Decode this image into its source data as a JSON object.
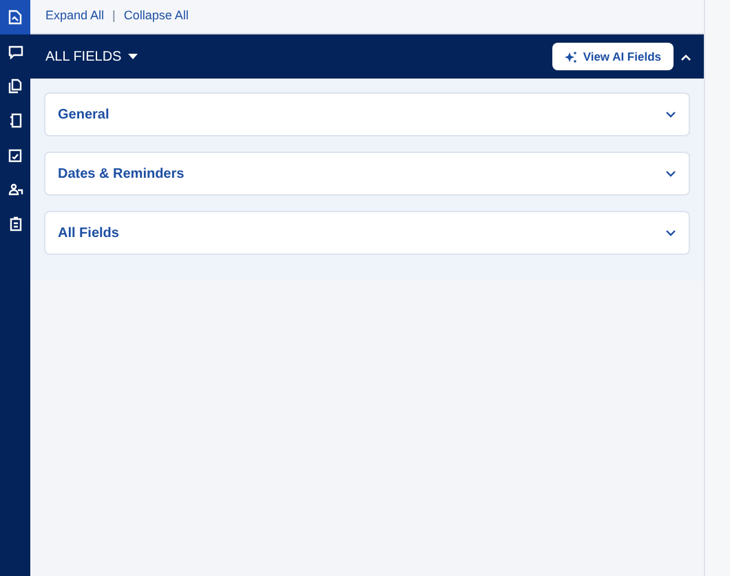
{
  "sidebar": {
    "items": [
      {
        "selected": true
      },
      {
        "selected": false
      },
      {
        "selected": false
      },
      {
        "selected": false
      },
      {
        "selected": false
      },
      {
        "selected": false
      },
      {
        "selected": false
      }
    ]
  },
  "toolbar": {
    "links": [
      "Expand All",
      "Collapse All"
    ],
    "separator": "|"
  },
  "header": {
    "title": "ALL FIELDS",
    "ai_button": "View AI Fields",
    "expanded": true
  },
  "sections": [
    {
      "title": "General",
      "expanded": false
    },
    {
      "title": "Dates & Reminders",
      "expanded": false
    },
    {
      "title": "All Fields",
      "expanded": false
    }
  ]
}
